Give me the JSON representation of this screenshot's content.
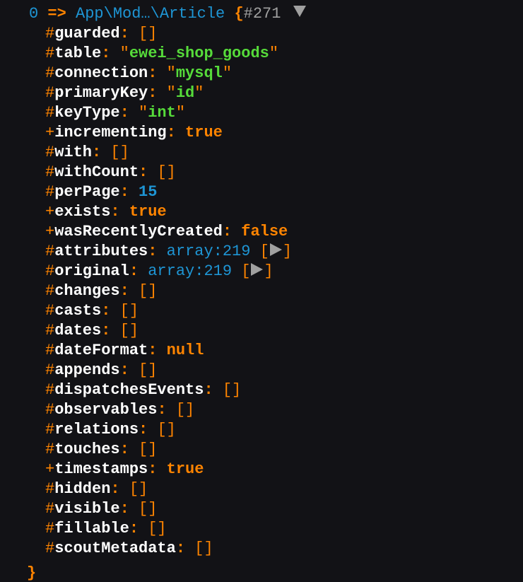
{
  "header": {
    "index": "0",
    "arrow": "=>",
    "class_name": "App\\Mod…\\Article",
    "open_brace": "{",
    "object_id": "#271"
  },
  "properties": [
    {
      "visibility": "#",
      "name": "guarded",
      "type": "empty-array",
      "value": "[]"
    },
    {
      "visibility": "#",
      "name": "table",
      "type": "string",
      "value": "ewei_shop_goods"
    },
    {
      "visibility": "#",
      "name": "connection",
      "type": "string",
      "value": "mysql"
    },
    {
      "visibility": "#",
      "name": "primaryKey",
      "type": "string",
      "value": "id"
    },
    {
      "visibility": "#",
      "name": "keyType",
      "type": "string",
      "value": "int"
    },
    {
      "visibility": "+",
      "name": "incrementing",
      "type": "const",
      "value": "true"
    },
    {
      "visibility": "#",
      "name": "with",
      "type": "empty-array",
      "value": "[]"
    },
    {
      "visibility": "#",
      "name": "withCount",
      "type": "empty-array",
      "value": "[]"
    },
    {
      "visibility": "#",
      "name": "perPage",
      "type": "number",
      "value": "15"
    },
    {
      "visibility": "+",
      "name": "exists",
      "type": "const",
      "value": "true"
    },
    {
      "visibility": "+",
      "name": "wasRecentlyCreated",
      "type": "const",
      "value": "false"
    },
    {
      "visibility": "#",
      "name": "attributes",
      "type": "array",
      "value": "array:219"
    },
    {
      "visibility": "#",
      "name": "original",
      "type": "array",
      "value": "array:219"
    },
    {
      "visibility": "#",
      "name": "changes",
      "type": "empty-array",
      "value": "[]"
    },
    {
      "visibility": "#",
      "name": "casts",
      "type": "empty-array",
      "value": "[]"
    },
    {
      "visibility": "#",
      "name": "dates",
      "type": "empty-array",
      "value": "[]"
    },
    {
      "visibility": "#",
      "name": "dateFormat",
      "type": "const",
      "value": "null"
    },
    {
      "visibility": "#",
      "name": "appends",
      "type": "empty-array",
      "value": "[]"
    },
    {
      "visibility": "#",
      "name": "dispatchesEvents",
      "type": "empty-array",
      "value": "[]"
    },
    {
      "visibility": "#",
      "name": "observables",
      "type": "empty-array",
      "value": "[]"
    },
    {
      "visibility": "#",
      "name": "relations",
      "type": "empty-array",
      "value": "[]"
    },
    {
      "visibility": "#",
      "name": "touches",
      "type": "empty-array",
      "value": "[]"
    },
    {
      "visibility": "+",
      "name": "timestamps",
      "type": "const",
      "value": "true"
    },
    {
      "visibility": "#",
      "name": "hidden",
      "type": "empty-array",
      "value": "[]"
    },
    {
      "visibility": "#",
      "name": "visible",
      "type": "empty-array",
      "value": "[]"
    },
    {
      "visibility": "#",
      "name": "fillable",
      "type": "empty-array",
      "value": "[]"
    },
    {
      "visibility": "#",
      "name": "scoutMetadata",
      "type": "empty-array",
      "value": "[]"
    }
  ],
  "closing": "}",
  "colors": {
    "background": "#121216",
    "key": "#ffffff",
    "punctuation": "#ff8400",
    "string": "#56db3a",
    "number": "#1e95d4",
    "class": "#1e95d4",
    "object_id": "#a0a0a0"
  }
}
